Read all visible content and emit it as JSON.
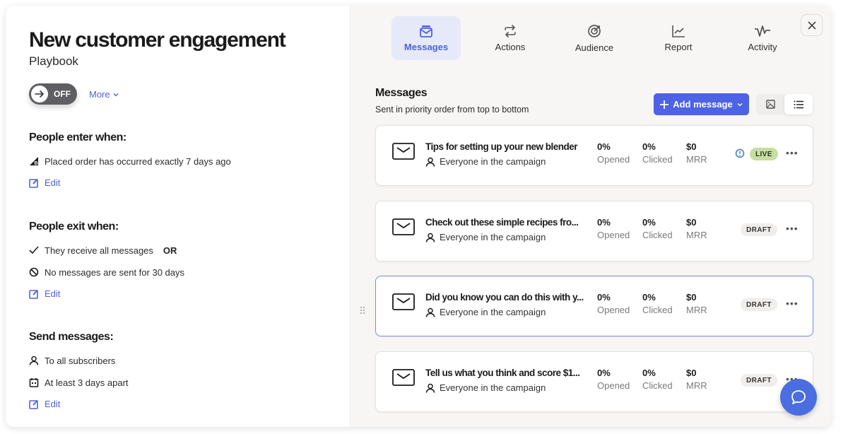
{
  "playbook": {
    "title": "New customer engagement",
    "subtitle": "Playbook",
    "toggle_label": "OFF",
    "more_label": "More"
  },
  "sections": {
    "enter": {
      "heading": "People enter when:",
      "rows": [
        {
          "icon": "bigcommerce-icon",
          "text": "Placed order has occurred exactly 7 days ago"
        }
      ],
      "edit_label": "Edit"
    },
    "exit": {
      "heading": "People exit when:",
      "rows": [
        {
          "icon": "check-icon",
          "text": "They receive all messages",
          "suffix": "OR"
        },
        {
          "icon": "prohibited-icon",
          "text": "No messages are sent for 30 days"
        }
      ],
      "edit_label": "Edit"
    },
    "send": {
      "heading": "Send messages:",
      "rows": [
        {
          "icon": "person-icon",
          "text": "To all subscribers"
        },
        {
          "icon": "calendar-icon",
          "text": "At least 3 days apart"
        }
      ],
      "edit_label": "Edit"
    }
  },
  "tabs": [
    {
      "label": "Messages",
      "icon": "inbox-icon",
      "active": true
    },
    {
      "label": "Actions",
      "icon": "repeat-icon"
    },
    {
      "label": "Audience",
      "icon": "target-icon"
    },
    {
      "label": "Report",
      "icon": "chart-icon"
    },
    {
      "label": "Activity",
      "icon": "pulse-icon"
    }
  ],
  "messages_panel": {
    "heading": "Messages",
    "subheading": "Sent in priority order from top to bottom",
    "add_button": "Add message",
    "accent": "#4d63e3"
  },
  "messages": [
    {
      "title": "Tips for setting up your new blender",
      "audience": "Everyone in the campaign",
      "opened": "0%",
      "opened_label": "Opened",
      "clicked": "0%",
      "clicked_label": "Clicked",
      "mrr": "$0",
      "mrr_label": "MRR",
      "status": "LIVE"
    },
    {
      "title": "Check out these simple recipes fro...",
      "audience": "Everyone in the campaign",
      "opened": "0%",
      "opened_label": "Opened",
      "clicked": "0%",
      "clicked_label": "Clicked",
      "mrr": "$0",
      "mrr_label": "MRR",
      "status": "DRAFT"
    },
    {
      "title": "Did you know you can do this with y...",
      "audience": "Everyone in the campaign",
      "opened": "0%",
      "opened_label": "Opened",
      "clicked": "0%",
      "clicked_label": "Clicked",
      "mrr": "$0",
      "mrr_label": "MRR",
      "status": "DRAFT"
    },
    {
      "title": "Tell us what you think and score $1...",
      "audience": "Everyone in the campaign",
      "opened": "0%",
      "opened_label": "Opened",
      "clicked": "0%",
      "clicked_label": "Clicked",
      "mrr": "$0",
      "mrr_label": "MRR",
      "status": "DRAFT"
    }
  ],
  "more_dots": "•••"
}
